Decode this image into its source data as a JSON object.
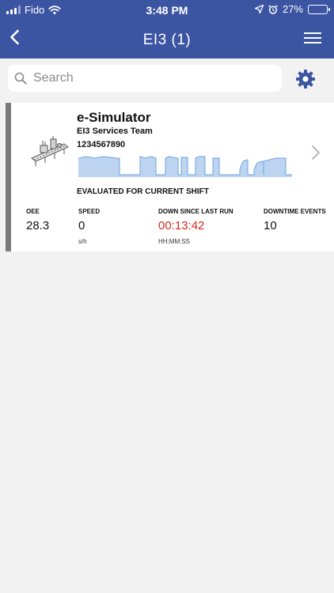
{
  "status_bar": {
    "carrier": "Fido",
    "time": "3:48 PM",
    "battery": "27%",
    "battery_level": 0.27
  },
  "nav": {
    "title": "EI3 (1)"
  },
  "search": {
    "placeholder": "Search",
    "value": ""
  },
  "colors": {
    "header": "#3c55a3",
    "accent_bar": "#7a7a7a",
    "alert": "#d22a1e",
    "sparkline": "#9cc1ec"
  },
  "card": {
    "title": "e-Simulator",
    "subtitle": "EI3 Services Team",
    "id": "1234567890",
    "evaluated_label": "EVALUATED FOR CURRENT SHIFT",
    "stats": [
      {
        "label": "OEE",
        "value": "28.3",
        "unit": ""
      },
      {
        "label": "SPEED",
        "value": "0",
        "unit": "s/h"
      },
      {
        "label": "DOWN SINCE LAST RUN",
        "value": "00:13:42",
        "unit": "HH:MM:SS"
      },
      {
        "label": "DOWNTIME EVENTS",
        "value": "10",
        "unit": ""
      }
    ]
  }
}
